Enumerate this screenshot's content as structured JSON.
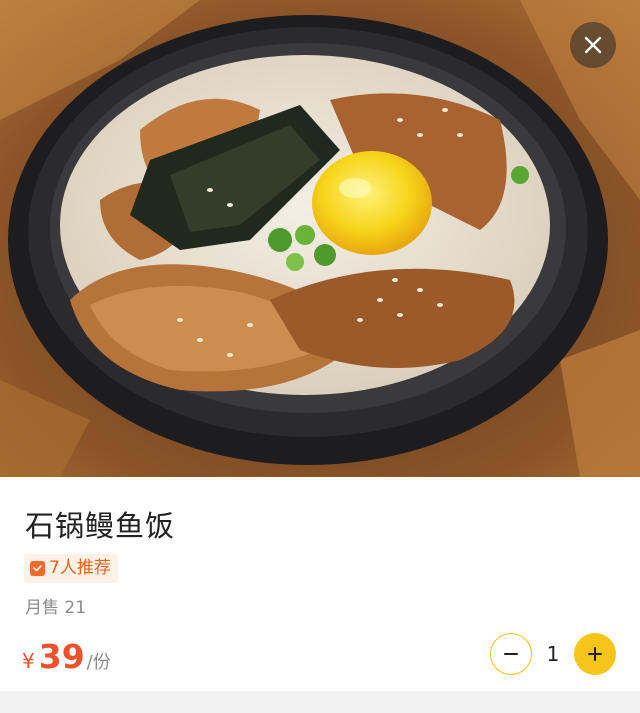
{
  "header": {
    "close_icon": "close-icon"
  },
  "hero": {
    "image_subject": "stone-pot eel rice bowl photo",
    "icon": "food-photo"
  },
  "dish": {
    "title": "石锅鳗鱼饭",
    "recommend": "7人推荐",
    "recommend_icon": "recommend-icon",
    "sales": "月售 21",
    "currency": "¥",
    "price": "39",
    "unit": "/份"
  },
  "stepper": {
    "quantity": "1",
    "minus_icon": "minus-icon",
    "plus_icon": "plus-icon"
  },
  "colors": {
    "price": "#f0512b",
    "accent_yellow": "#f7c51a",
    "badge_bg": "#fff1e6",
    "badge_text": "#e8641f"
  }
}
